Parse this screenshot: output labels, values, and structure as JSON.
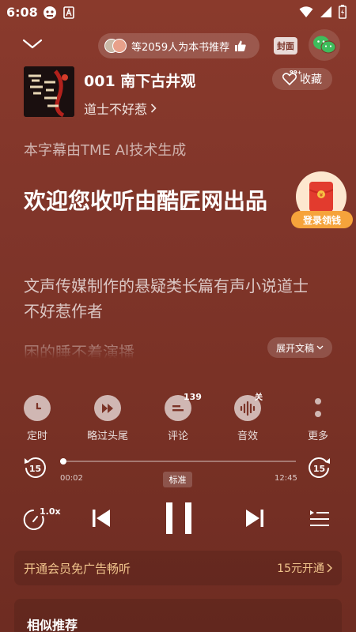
{
  "status_bar": {
    "time": "6:08"
  },
  "header": {
    "recommend_text": "等2059人为本书推荐",
    "cover_label": "封面"
  },
  "book": {
    "title": "001 南下古井观",
    "author": "道士不好惹",
    "favorite_label": "收藏",
    "favorite_count": "99+"
  },
  "subtitles": {
    "ai_note": "本字幕由TME AI技术生成",
    "current": "欢迎您收听由酷匠网出品",
    "next": "文声传媒制作的悬疑类长篇有声小说道士不好惹作者",
    "fade": "困的睡不着演播",
    "expand_label": "展开文稿"
  },
  "promo": {
    "label": "登录领钱"
  },
  "functions": [
    {
      "label": "定时",
      "icon": "clock-icon"
    },
    {
      "label": "略过头尾",
      "icon": "skip-intro-icon"
    },
    {
      "label": "评论",
      "icon": "comment-icon",
      "count": "139"
    },
    {
      "label": "音效",
      "icon": "sound-effect-icon",
      "badge": "关"
    },
    {
      "label": "更多",
      "icon": "more-icon"
    }
  ],
  "progress": {
    "elapsed": "00:02",
    "total": "12:45",
    "fraction": 0.003,
    "quality_label": "标准",
    "skip_seconds": "15"
  },
  "controls": {
    "speed_label": "1.0x"
  },
  "vip": {
    "text": "开通会员免广告畅听",
    "cta": "15元开通"
  },
  "similar": {
    "title": "相似推荐"
  },
  "colors": {
    "background": "#80352a",
    "vip_gold": "#f1c58d",
    "promo_orange": "#f6a33b",
    "wechat_green": "#3ebd5c"
  }
}
